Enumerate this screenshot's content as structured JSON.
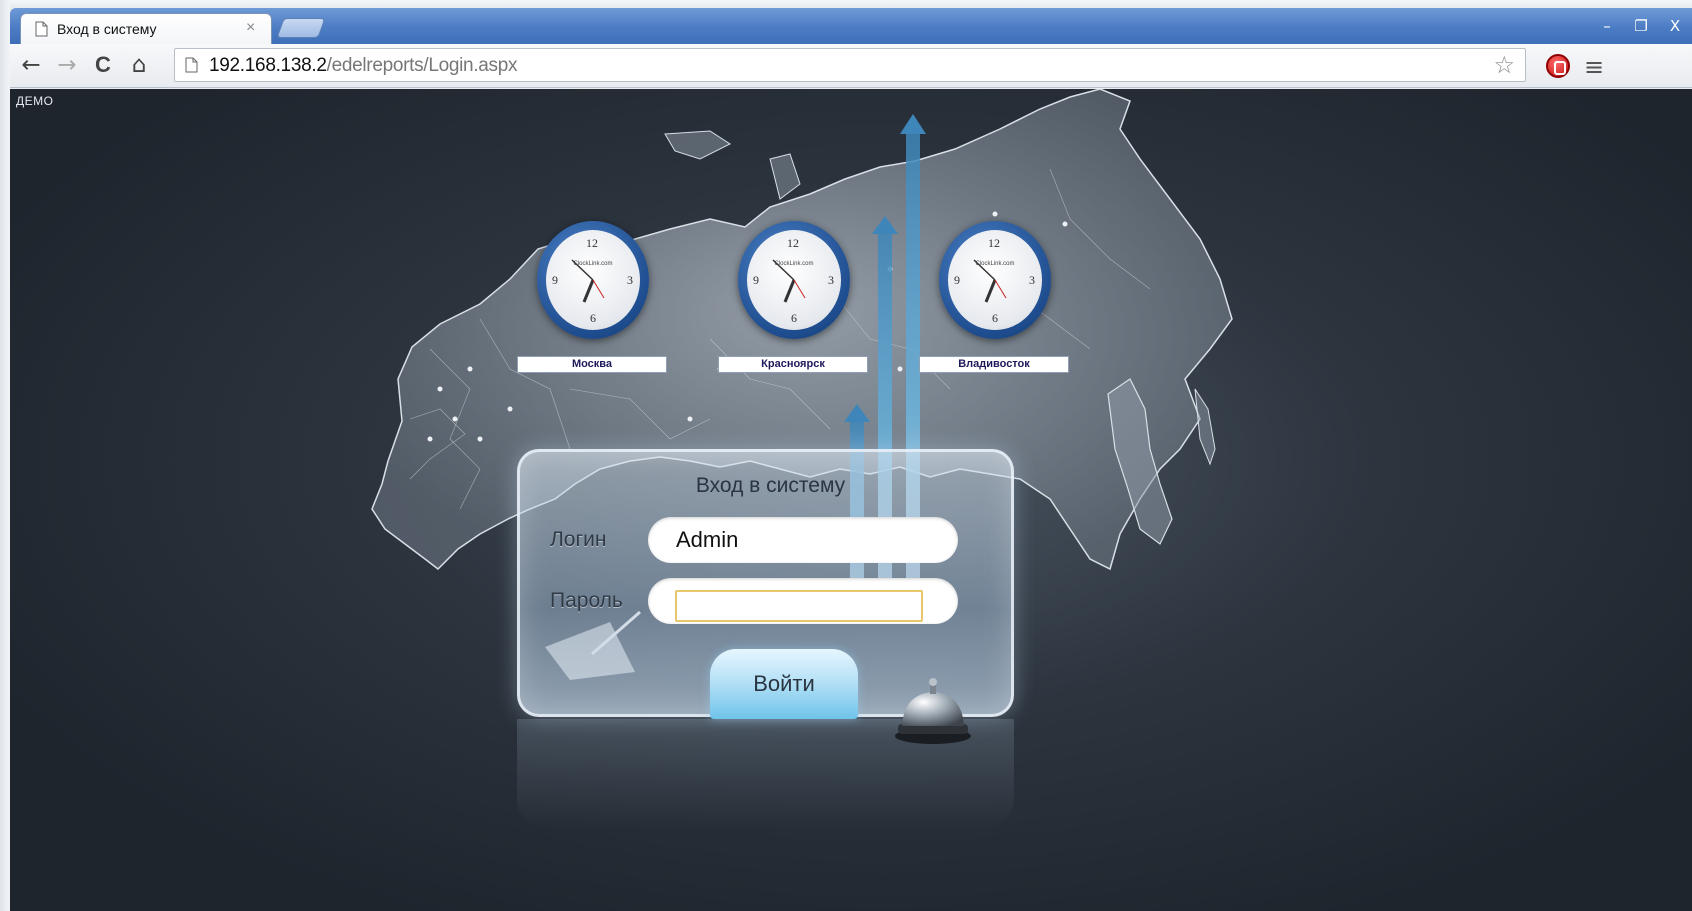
{
  "browser": {
    "tab_title": "Вход в систему",
    "tab_close": "×",
    "url_host": "192.168.138.2",
    "url_path": "/edelreports/Login.aspx",
    "window_controls": {
      "minimize": "–",
      "restore": "❐",
      "close": "X"
    },
    "nav": {
      "back": "←",
      "forward": "→",
      "reload": "C",
      "home": "⌂"
    },
    "bookmark_star": "☆",
    "menu": "≡"
  },
  "page": {
    "demo_label": "ДЕМО",
    "clocks": [
      {
        "city": "Москва",
        "brand": "ClockLink.com",
        "n12": "12",
        "n3": "3",
        "n6": "6",
        "n9": "9"
      },
      {
        "city": "Красноярск",
        "brand": "ClockLink.com",
        "n12": "12",
        "n3": "3",
        "n6": "6",
        "n9": "9"
      },
      {
        "city": "Владивосток",
        "brand": "ClockLink.com",
        "n12": "12",
        "n3": "3",
        "n6": "6",
        "n9": "9"
      }
    ],
    "login": {
      "title": "Вход в систему",
      "login_label": "Логин",
      "login_value": "Admin",
      "password_label": "Пароль",
      "password_value": "",
      "submit_label": "Войти"
    }
  },
  "colors": {
    "background": "#1f252d",
    "titlebar": "#4c7cc4",
    "city_label_text": "#1d1a5a",
    "button": "#b7e1f6",
    "password_focus": "#e8c66c"
  },
  "icons": [
    "page-icon",
    "close-icon",
    "new-tab-icon",
    "back-icon",
    "forward-icon",
    "reload-icon",
    "home-icon",
    "star-icon",
    "extension-icon",
    "menu-icon",
    "bell-icon",
    "quill-icon",
    "arrow-icon"
  ]
}
